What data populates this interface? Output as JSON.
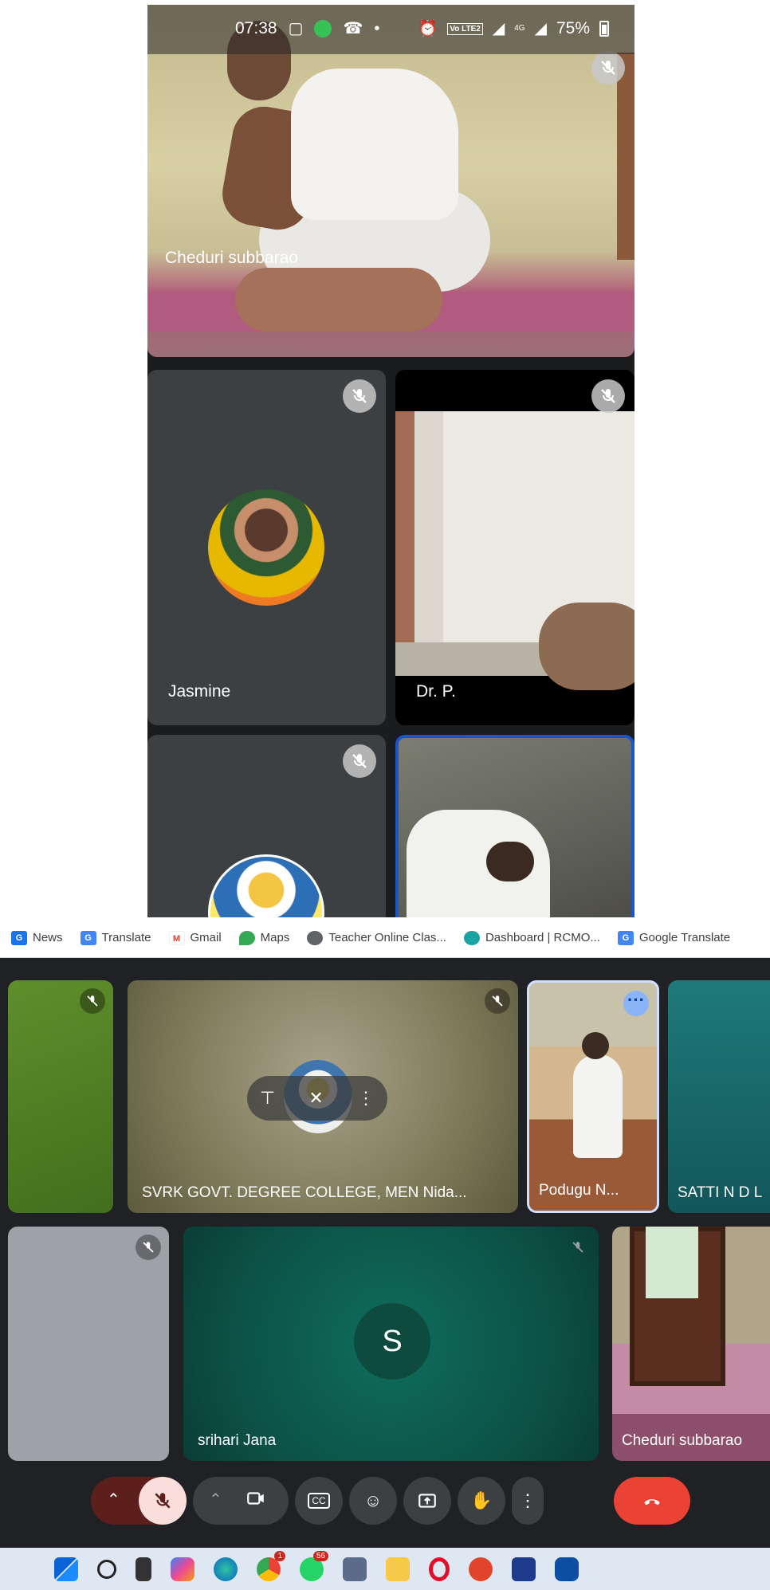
{
  "phone": {
    "status_bar": {
      "time": "07:38",
      "battery": "75%",
      "network": "Vo LTE2",
      "signal_label": "4G"
    },
    "tiles": [
      {
        "name": "Cheduri subbarao",
        "muted": true,
        "kind": "video"
      },
      {
        "name": "Jasmine",
        "muted": true,
        "kind": "avatar"
      },
      {
        "name": "Dr. P.",
        "muted": true,
        "kind": "video"
      },
      {
        "name": "",
        "muted": true,
        "kind": "avatar"
      },
      {
        "name": "",
        "muted": false,
        "kind": "video",
        "active": true
      }
    ]
  },
  "laptop": {
    "bookmarks": [
      {
        "label": "News",
        "icon": "news-icon",
        "color": "#1a73e8"
      },
      {
        "label": "Translate",
        "icon": "translate-icon",
        "color": "#4285f4"
      },
      {
        "label": "Gmail",
        "icon": "gmail-icon",
        "color": "#ea4335"
      },
      {
        "label": "Maps",
        "icon": "maps-icon",
        "color": "#34a853"
      },
      {
        "label": "Teacher Online Clas...",
        "icon": "globe-icon",
        "color": "#5f6368"
      },
      {
        "label": "Dashboard | RCMO...",
        "icon": "dashboard-icon",
        "color": "#1aa3a3"
      },
      {
        "label": "Google Translate",
        "icon": "translate-icon",
        "color": "#4285f4"
      }
    ],
    "tiles": [
      {
        "name": "",
        "muted": true
      },
      {
        "name": "SVRK GOVT. DEGREE COLLEGE, MEN Nida...",
        "muted": true,
        "pinned_menu": true
      },
      {
        "name": "Podugu N...",
        "muted": false
      },
      {
        "name": "SATTI N D L",
        "muted": false
      },
      {
        "name": "",
        "muted": true
      },
      {
        "name": "srihari Jana",
        "muted": true,
        "avatar_letter": "S"
      },
      {
        "name": "Cheduri subbarao",
        "muted": false
      }
    ],
    "controls": {
      "mic": "mic-off-icon",
      "camera": "camera-icon",
      "captions": "CC",
      "emoji": "emoji-icon",
      "present": "present-icon",
      "raise_hand": "hand-icon",
      "more": "more-vert-icon",
      "leave": "call-end-icon"
    },
    "taskbar_badges": {
      "chrome": "1",
      "whatsapp": "56"
    }
  },
  "colors": {
    "meet_bg": "#202124",
    "tile_bg": "#3c4043",
    "leave_red": "#ea4335",
    "active_border": "#1a56c9"
  }
}
